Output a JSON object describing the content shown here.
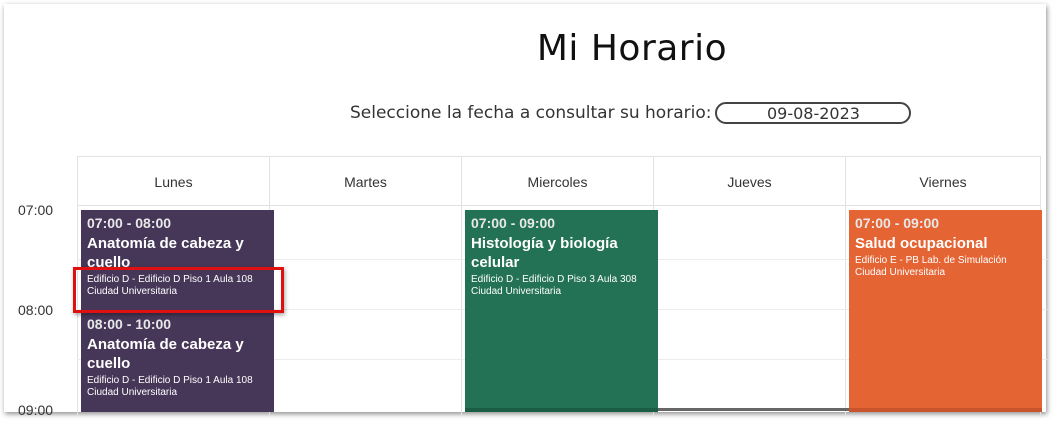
{
  "page": {
    "title": "Mi Horario",
    "date_label": "Seleccione la fecha a consultar su horario:",
    "date_value": "09-08-2023"
  },
  "days": [
    "Lunes",
    "Martes",
    "Miercoles",
    "Jueves",
    "Viernes"
  ],
  "hours": [
    "07:00",
    "08:00",
    "09:00"
  ],
  "colors": {
    "purple": "#463758",
    "green": "#237255",
    "orange": "#e56434",
    "highlight": "#e01010"
  },
  "events": [
    {
      "time": "07:00 - 08:00",
      "title": "Anatomía de cabeza y cuello",
      "location_1": "Edificio D - Edificio D Piso 1 Aula 108",
      "location_2": "Ciudad Universitaria"
    },
    {
      "time": "08:00 - 10:00",
      "title": "Anatomía de cabeza y cuello",
      "location_1": "Edificio D - Edificio D Piso 1 Aula 108",
      "location_2": "Ciudad Universitaria"
    },
    {
      "time": "07:00 - 09:00",
      "title": "Histología y biología celular",
      "location_1": "Edificio D - Edificio D Piso 3 Aula 308",
      "location_2": "Ciudad Universitaria"
    },
    {
      "time": "07:00 - 09:00",
      "title": "Salud ocupacional",
      "location_1": "Edificio E - PB Lab. de Simulación",
      "location_2": "Ciudad Universitaria"
    }
  ]
}
